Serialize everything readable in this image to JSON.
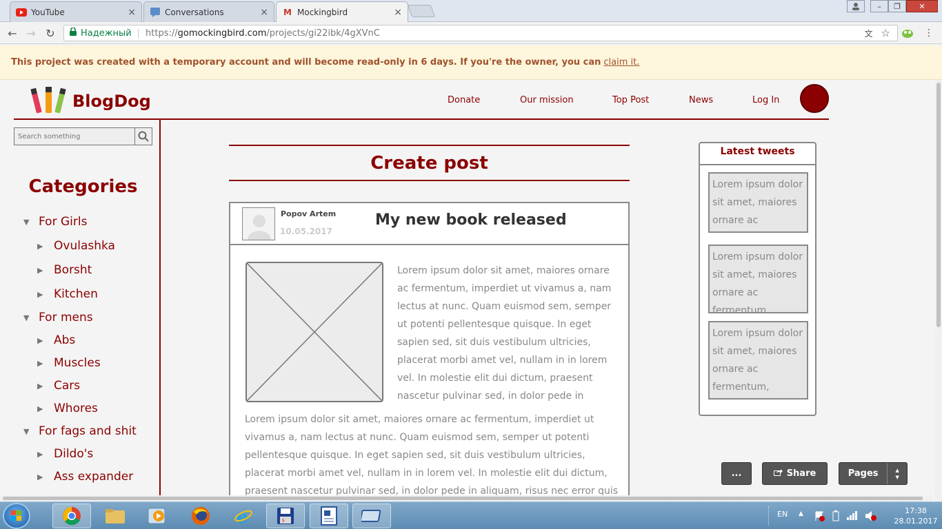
{
  "browser": {
    "tabs": [
      {
        "label": "YouTube",
        "icon": "youtube-icon"
      },
      {
        "label": "Conversations",
        "icon": "chat-icon"
      },
      {
        "label": "Mockingbird",
        "icon": "mockingbird-icon"
      }
    ],
    "secure_label": "Надежный",
    "url_prefix": "https://",
    "url_domain": "gomockingbird.com",
    "url_path": "/projects/gi22ibk/4gXVnC"
  },
  "notice": {
    "text": "This project was created with a temporary account and will become read-only in 6 days. If you're the owner, you can",
    "link": "claim it."
  },
  "site": {
    "brand": "BlogDog",
    "nav": [
      "Donate",
      "Our mission",
      "Top Post",
      "News",
      "Log In"
    ],
    "search_placeholder": "Search something",
    "categories_title": "Categories",
    "categories": [
      {
        "label": "For Girls",
        "children": [
          "Ovulashka",
          "Borsht",
          "Kitchen"
        ]
      },
      {
        "label": "For mens",
        "children": [
          "Abs",
          "Muscles",
          "Cars",
          "Whores"
        ]
      },
      {
        "label": "For fags and shit",
        "children": [
          "Dildo's",
          "Ass expander"
        ]
      }
    ]
  },
  "main": {
    "heading": "Create post",
    "post": {
      "author": "Popov Artem",
      "date": "10.05.2017",
      "title": "My new book released",
      "para1": "Lorem ipsum dolor sit amet, maiores ornare ac fermentum, imperdiet ut vivamus a, nam lectus at nunc. Quam euismod sem, semper ut potenti pellentesque quisque. In eget sapien sed, sit duis vestibulum ultricies, placerat morbi amet vel, nullam in in lorem vel. In molestie elit dui dictum, praesent nascetur pulvinar sed, in dolor pede in",
      "para2": "Lorem ipsum dolor sit amet, maiores ornare ac fermentum, imperdiet ut vivamus a, nam lectus at nunc. Quam euismod sem, semper ut potenti pellentesque quisque. In eget sapien sed, sit duis vestibulum ultricies, placerat morbi amet vel, nullam in in lorem vel. In molestie elit dui dictum, praesent nascetur pulvinar sed, in dolor pede in aliquam, risus nec error quis"
    }
  },
  "tweets": {
    "title": "Latest tweets",
    "items": [
      "Lorem ipsum dolor sit amet, maiores ornare ac",
      "Lorem ipsum dolor sit amet, maiores ornare ac fermentum,",
      "Lorem ipsum dolor sit amet, maiores ornare ac fermentum, imperdiet ut"
    ]
  },
  "buttons": {
    "more": "...",
    "share": "Share",
    "pages": "Pages"
  },
  "taskbar": {
    "lang": "EN",
    "time": "17:38",
    "date": "28.01.2017"
  },
  "colors": {
    "brand": "#8b0000",
    "notice_bg": "#fdf6dc",
    "notice_text": "#a0522d",
    "secure": "#0b8043"
  }
}
